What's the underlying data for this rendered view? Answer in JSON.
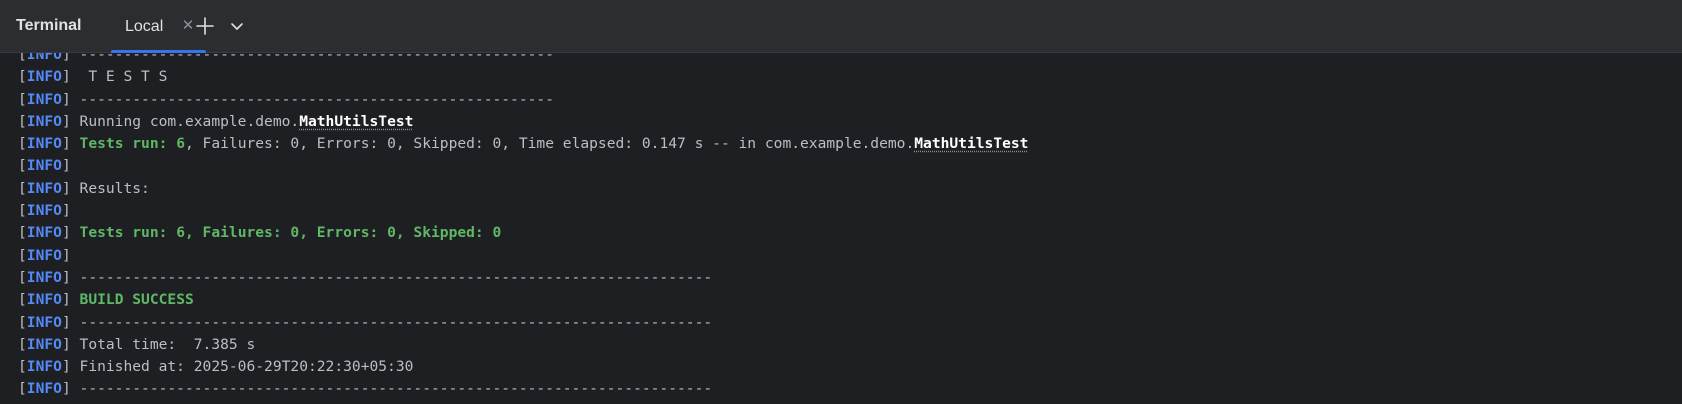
{
  "toolbar": {
    "panel_title": "Terminal",
    "tab_label": "Local",
    "close_icon": "close-icon",
    "add_icon": "plus-icon",
    "dropdown_icon": "chevron-down-icon"
  },
  "colors": {
    "background": "#1e1f22",
    "toolbar": "#2b2d30",
    "info_tag": "#548af7",
    "success": "#5fb865",
    "text": "#bcbec4",
    "tab_accent": "#3574f0"
  },
  "terminal": {
    "lines": [
      {
        "level": "INFO",
        "text": " ------------------------------------------------------"
      },
      {
        "level": "INFO",
        "text": "  T E S T S"
      },
      {
        "level": "INFO",
        "text": " ------------------------------------------------------"
      },
      {
        "level": "INFO",
        "text": " Running com.example.demo.",
        "cls": "MathUtilsTest"
      },
      {
        "level": "INFO",
        "text": " ",
        "green": "Tests run: 6",
        "rest": ", Failures: 0, Errors: 0, Skipped: 0, Time elapsed: 0.147 s -- in com.example.demo.",
        "cls": "MathUtilsTest"
      },
      {
        "level": "INFO",
        "text": ""
      },
      {
        "level": "INFO",
        "text": " Results:"
      },
      {
        "level": "INFO",
        "text": ""
      },
      {
        "level": "INFO",
        "text": " ",
        "green": "Tests run: 6, Failures: 0, Errors: 0, Skipped: 0"
      },
      {
        "level": "INFO",
        "text": ""
      },
      {
        "level": "INFO",
        "text": " ------------------------------------------------------------------------"
      },
      {
        "level": "INFO",
        "text": " ",
        "green": "BUILD SUCCESS"
      },
      {
        "level": "INFO",
        "text": " ------------------------------------------------------------------------"
      },
      {
        "level": "INFO",
        "text": " Total time:  7.385 s"
      },
      {
        "level": "INFO",
        "text": " Finished at: 2025-06-29T20:22:30+05:30"
      },
      {
        "level": "INFO",
        "text": " ------------------------------------------------------------------------"
      }
    ]
  }
}
